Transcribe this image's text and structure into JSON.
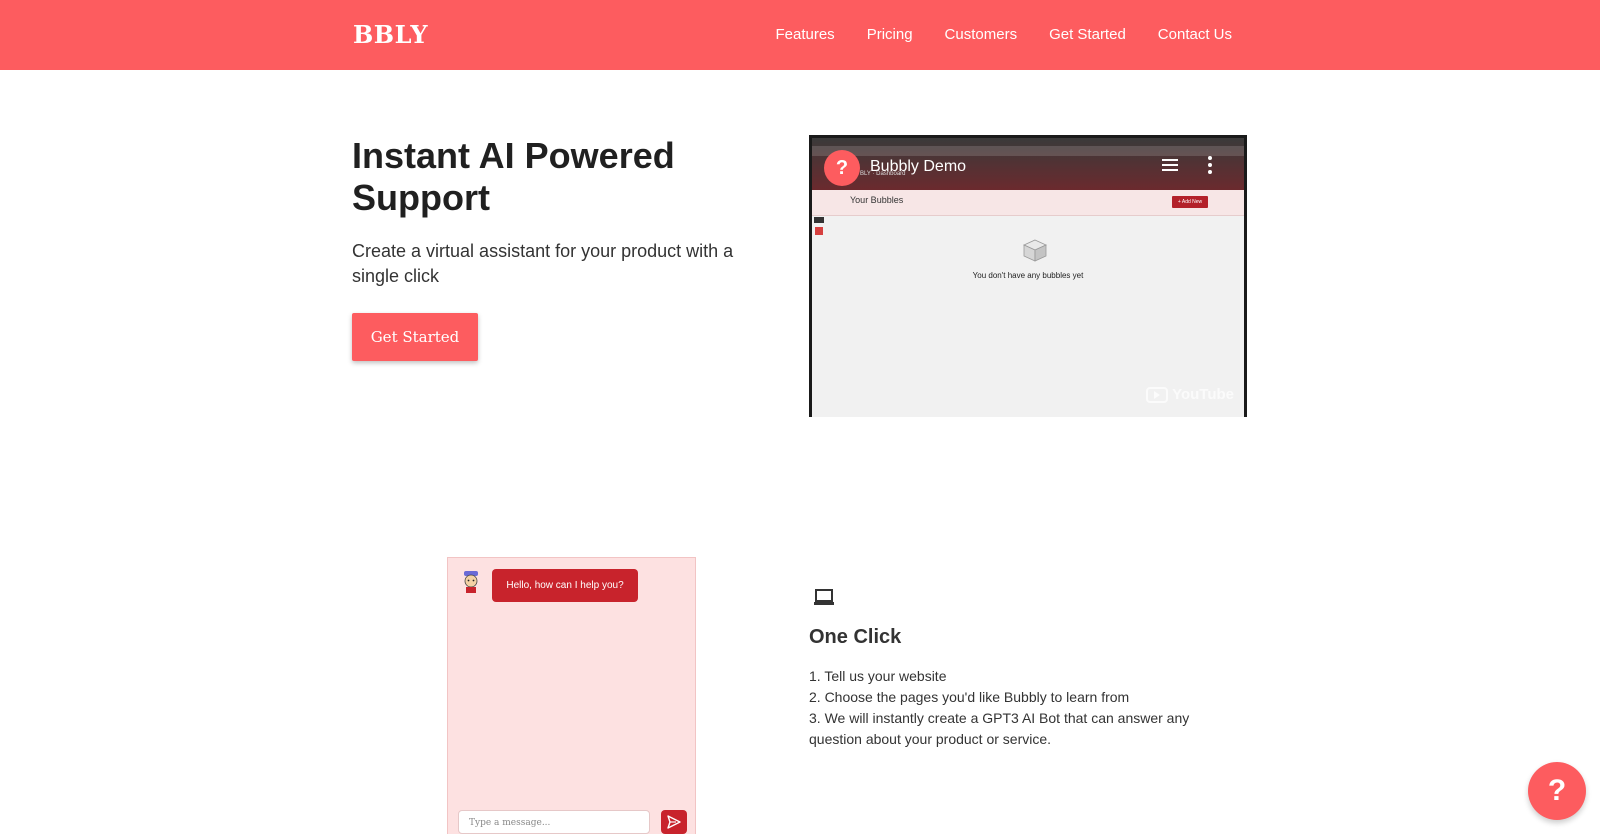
{
  "header": {
    "logo": "BBLY",
    "nav": [
      "Features",
      "Pricing",
      "Customers",
      "Get Started",
      "Contact Us"
    ],
    "background_color": "#fd5c5f"
  },
  "hero": {
    "title": "Instant AI Powered Support",
    "subtitle": "Create a virtual assistant for your product with a single click",
    "cta_label": "Get Started"
  },
  "video": {
    "badge": "?",
    "title": "Bubbly Demo",
    "brand_partial": "BLY",
    "dashboard_label": "Dashboard",
    "section_title": "Your Bubbles",
    "add_new_label": "+ Add New",
    "empty_message": "You don't have any bubbles yet",
    "platform": "YouTube",
    "icons": [
      "queue-icon",
      "more-vertical-icon",
      "box-icon",
      "youtube-logo"
    ]
  },
  "chat_demo": {
    "greeting": "Hello, how can I help you?",
    "input_placeholder": "Type a message...",
    "icons": [
      "avatar",
      "send-icon"
    ],
    "background_color": "#fde1e1",
    "bubble_color": "#c8232c"
  },
  "features": {
    "icon": "laptop-icon",
    "title": "One Click",
    "steps": [
      "1. Tell us your website",
      "2. Choose the pages you'd like Bubbly to learn from",
      "3. We will instantly create a GPT3 AI Bot that can answer any question about your product or service."
    ]
  },
  "help_button": {
    "label": "?"
  }
}
